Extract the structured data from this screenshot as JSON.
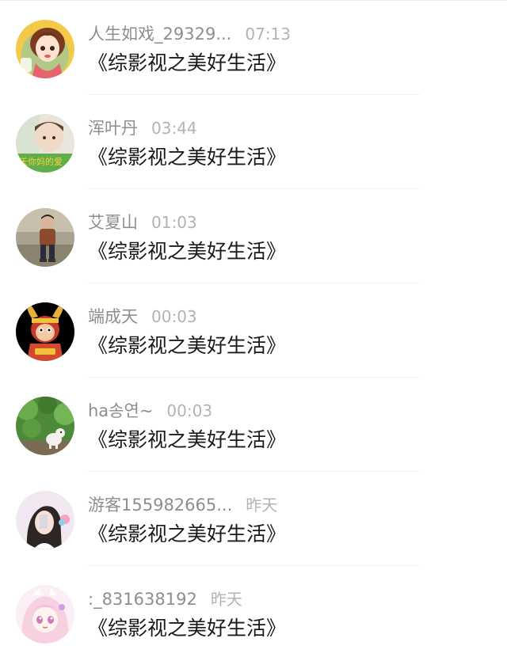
{
  "comments": [
    {
      "name": "人生如戏_29329...",
      "time": "07:13",
      "message": "《综影视之美好生活》",
      "avatar_icon": "avatar-cartoon-girl-icon"
    },
    {
      "name": "浑叶丹",
      "time": "03:44",
      "message": "《综影视之美好生活》",
      "avatar_icon": "avatar-photo-boy-icon"
    },
    {
      "name": "艾夏山",
      "time": "01:03",
      "message": "《综影视之美好生活》",
      "avatar_icon": "avatar-photo-child-icon"
    },
    {
      "name": "端成天",
      "time": "00:03",
      "message": "《综影视之美好生活》",
      "avatar_icon": "avatar-monkey-king-icon"
    },
    {
      "name": "ha송연~",
      "time": "00:03",
      "message": "《综影视之美好生活》",
      "avatar_icon": "avatar-cat-plants-icon"
    },
    {
      "name": "游客155982665...",
      "time": "昨天",
      "message": "《综影视之美好生活》",
      "avatar_icon": "avatar-photo-girl-icon"
    },
    {
      "name": ":_831638192",
      "time": "昨天",
      "message": "《综影视之美好生活》",
      "avatar_icon": "avatar-anime-girl-icon"
    }
  ],
  "colors": {
    "name": "#8e8e8e",
    "time": "#b3b3b3",
    "message": "#1a1a1a",
    "divider": "#f0f0f0"
  }
}
